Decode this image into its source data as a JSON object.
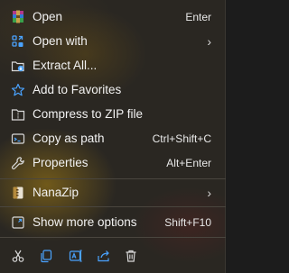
{
  "menu": {
    "items": [
      {
        "label": "Open",
        "shortcut": "Enter",
        "icon": "winrar-archive-icon"
      },
      {
        "label": "Open with",
        "shortcut": "",
        "icon": "open-with-icon",
        "submenu": "›"
      },
      {
        "label": "Extract All...",
        "shortcut": "",
        "icon": "extract-all-icon"
      },
      {
        "label": "Add to Favorites",
        "shortcut": "",
        "icon": "star-icon"
      },
      {
        "label": "Compress to ZIP file",
        "shortcut": "",
        "icon": "zip-folder-icon"
      },
      {
        "label": "Copy as path",
        "shortcut": "Ctrl+Shift+C",
        "icon": "copy-path-icon"
      },
      {
        "label": "Properties",
        "shortcut": "Alt+Enter",
        "icon": "wrench-icon"
      }
    ],
    "nanazip": {
      "label": "NanaZip",
      "icon": "nanazip-icon",
      "submenu": "›"
    },
    "more": {
      "label": "Show more options",
      "shortcut": "Shift+F10",
      "icon": "show-more-icon"
    }
  },
  "toolbar": {
    "icons": [
      "cut-icon",
      "copy-icon",
      "rename-icon",
      "share-icon",
      "delete-icon"
    ]
  },
  "colors": {
    "text": "#f2f2f2",
    "accent_blue": "#4aa3ff",
    "separator": "#4a463f"
  }
}
